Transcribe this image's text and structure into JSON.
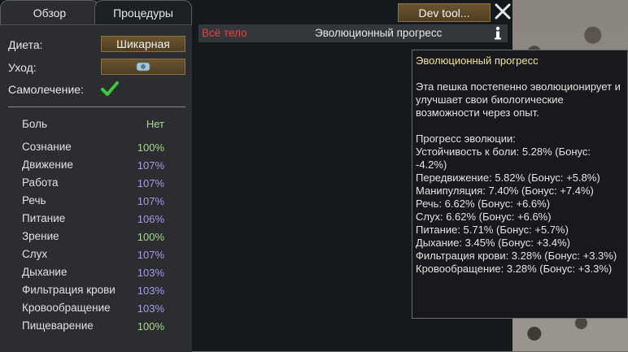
{
  "tabs": {
    "overview": "Обзор",
    "procedures": "Процедуры"
  },
  "settings": {
    "diet_label": "Диета:",
    "diet_value": "Шикарная",
    "care_label": "Уход:",
    "self_tend_label": "Самолечение:",
    "self_tend_checked": true
  },
  "pain": {
    "label": "Боль",
    "value": "Нет"
  },
  "capacities": [
    {
      "name": "Сознание",
      "value": "100%",
      "state": "normal"
    },
    {
      "name": "Движение",
      "value": "107%",
      "state": "boosted"
    },
    {
      "name": "Работа",
      "value": "107%",
      "state": "boosted"
    },
    {
      "name": "Речь",
      "value": "107%",
      "state": "boosted"
    },
    {
      "name": "Питание",
      "value": "106%",
      "state": "boosted"
    },
    {
      "name": "Зрение",
      "value": "100%",
      "state": "normal"
    },
    {
      "name": "Слух",
      "value": "107%",
      "state": "boosted"
    },
    {
      "name": "Дыхание",
      "value": "103%",
      "state": "boosted"
    },
    {
      "name": "Фильтрация крови",
      "value": "103%",
      "state": "boosted"
    },
    {
      "name": "Кровообращение",
      "value": "103%",
      "state": "boosted"
    },
    {
      "name": "Пищеварение",
      "value": "100%",
      "state": "normal"
    }
  ],
  "health": {
    "body_part": "Всё тело",
    "hediff": "Эволюционный прогресс"
  },
  "toolbar": {
    "dev_tool_label": "Dev tool..."
  },
  "tooltip": {
    "title": "Эволюционный прогресс",
    "description": "Эта пешка постепенно эволюционирует и улучшает свои биологические возможности через опыт.",
    "lines": [
      "Прогресс эволюции:",
      "Устойчивость к боли: 5.28% (Бонус: -4.2%)",
      "Передвижение: 5.82% (Бонус: +5.8%)",
      "Манипуляция: 7.40% (Бонус: +7.4%)",
      "Речь: 6.62% (Бонус: +6.6%)",
      "Слух: 6.62% (Бонус: +6.6%)",
      "Питание: 5.71% (Бонус: +5.7%)",
      "Дыхание: 3.45% (Бонус: +3.4%)",
      "Фильтрация крови: 3.28% (Бонус: +3.3%)",
      "Кровообращение: 3.28% (Бонус: +3.3%)"
    ]
  },
  "colors": {
    "normal_value": "#a6d98c",
    "boosted_value": "#a59be8",
    "body_part": "#e0453c",
    "tooltip_title": "#f2e394",
    "checkmark": "#3cc93c"
  },
  "icons": {
    "care": "medicine-icon",
    "info": "info-icon",
    "close": "close-icon",
    "self_tend": "checkmark-icon"
  }
}
